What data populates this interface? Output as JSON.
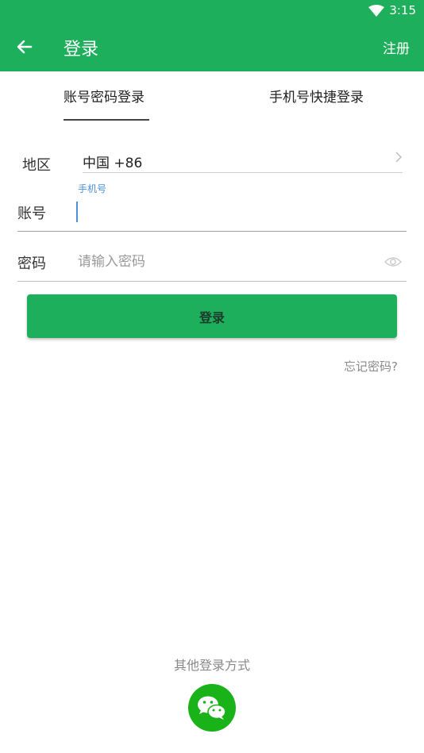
{
  "status_bar": {
    "time": "3:15",
    "wifi_icon": "wifi-icon"
  },
  "app_bar": {
    "back_icon": "arrow-left-icon",
    "title": "登录",
    "register_label": "注册"
  },
  "tabs": [
    {
      "label": "账号密码登录",
      "selected": true
    },
    {
      "label": "手机号快捷登录",
      "selected": false
    }
  ],
  "form": {
    "region": {
      "label": "地区",
      "value": "中国 +86",
      "chevron_icon": "chevron-right-icon"
    },
    "account": {
      "label": "账号",
      "floating_hint": "手机号",
      "value": ""
    },
    "password": {
      "label": "密码",
      "placeholder": "请输入密码",
      "eye_icon": "eye-icon"
    },
    "login_button": "登录",
    "forgot_password": "忘记密码?"
  },
  "other_login": {
    "label": "其他登录方式",
    "wechat_icon": "wechat-icon"
  },
  "colors": {
    "primary": "#1daf5c",
    "wechat": "#19b319",
    "hint": "#4a90d9"
  }
}
